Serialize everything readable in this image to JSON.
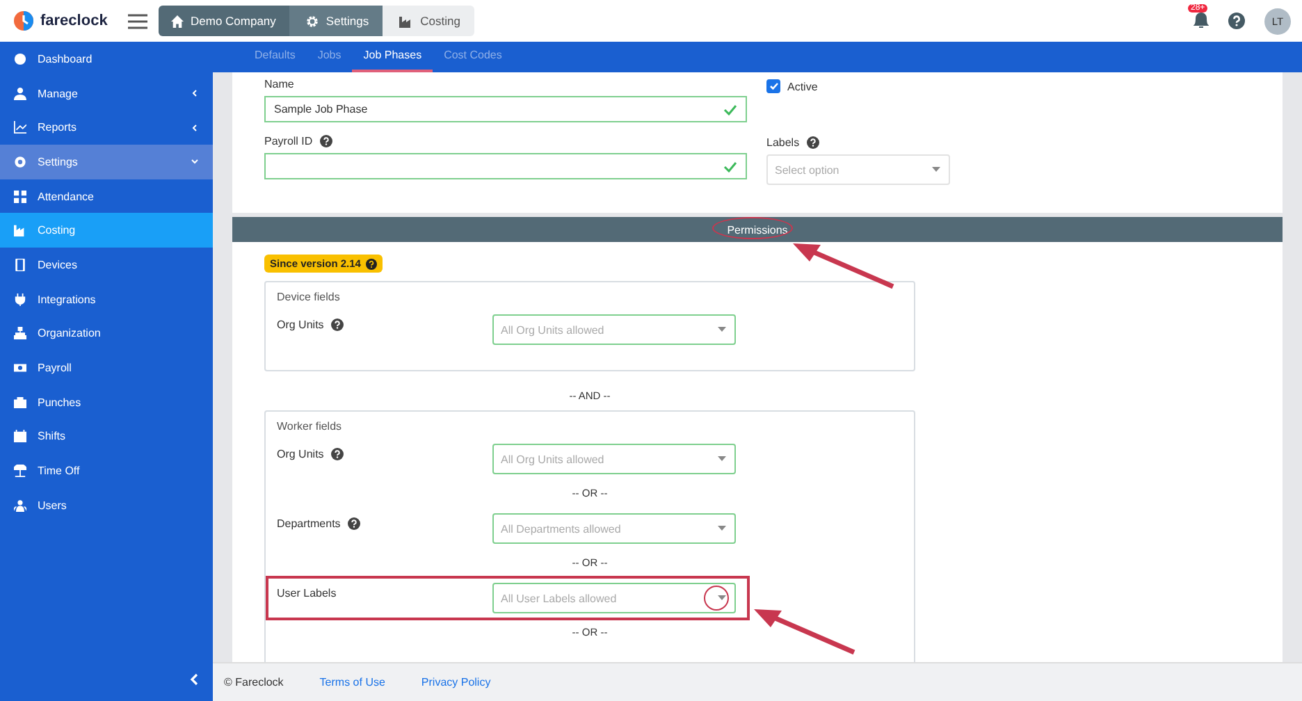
{
  "header": {
    "logo_text": "fareclock",
    "breadcrumbs": [
      {
        "label": "Demo Company",
        "kind": "home"
      },
      {
        "label": "Settings",
        "kind": "settings"
      },
      {
        "label": "Costing",
        "kind": "costing"
      }
    ],
    "notification_count": "28+",
    "avatar": "LT"
  },
  "sidebar": {
    "items": [
      {
        "label": "Dashboard",
        "kind": "dashboard",
        "selected": false,
        "has_submenu": false,
        "expanded": false
      },
      {
        "label": "Manage",
        "kind": "manage",
        "selected": false,
        "has_submenu": true,
        "expanded": false
      },
      {
        "label": "Reports",
        "kind": "reports",
        "selected": false,
        "has_submenu": true,
        "expanded": false
      },
      {
        "label": "Settings",
        "kind": "settings",
        "selected": false,
        "has_submenu": true,
        "expanded": true,
        "children": [
          {
            "label": "Attendance",
            "kind": "attendance",
            "selected": false,
            "has_submenu": false,
            "expanded": false
          },
          {
            "label": "Costing",
            "kind": "costing",
            "selected": true,
            "has_submenu": false,
            "expanded": false
          }
        ]
      },
      {
        "label": "Devices",
        "kind": "devices",
        "selected": false,
        "has_submenu": false,
        "expanded": false
      },
      {
        "label": "Integrations",
        "kind": "integrations",
        "selected": false,
        "has_submenu": false,
        "expanded": false
      },
      {
        "label": "Organization",
        "kind": "organization",
        "selected": false,
        "has_submenu": false,
        "expanded": false
      },
      {
        "label": "Payroll",
        "kind": "payroll",
        "selected": false,
        "has_submenu": false,
        "expanded": false
      },
      {
        "label": "Punches",
        "kind": "punches",
        "selected": false,
        "has_submenu": false,
        "expanded": false
      },
      {
        "label": "Shifts",
        "kind": "shifts",
        "selected": false,
        "has_submenu": false,
        "expanded": false
      },
      {
        "label": "Time Off",
        "kind": "timeoff",
        "selected": false,
        "has_submenu": false,
        "expanded": false
      },
      {
        "label": "Users",
        "kind": "users",
        "selected": false,
        "has_submenu": false,
        "expanded": false
      }
    ]
  },
  "tabs": [
    {
      "label": "Defaults",
      "selected": false
    },
    {
      "label": "Jobs",
      "selected": false
    },
    {
      "label": "Job Phases",
      "selected": true
    },
    {
      "label": "Cost Codes",
      "selected": false
    }
  ],
  "form": {
    "name": {
      "label": "Name",
      "value": "Sample Job Phase",
      "valid": true
    },
    "active": {
      "label": "Active",
      "checked": true
    },
    "payroll_id": {
      "label": "Payroll ID",
      "valid": true
    },
    "labels": {
      "label": "Labels",
      "placeholder": "Select option"
    }
  },
  "permissions": {
    "title": "Permissions",
    "badge": "Since version 2.14",
    "groups": [
      {
        "title": "Device fields",
        "items": [
          {
            "kind": "field",
            "label": "Org Units",
            "help": true,
            "placeholder": "All Org Units allowed"
          }
        ]
      },
      {
        "kind": "separator",
        "text": "-- AND --",
        "title": "Worker fields",
        "items": [
          {
            "kind": "field",
            "label": "Org Units",
            "help": true,
            "placeholder": "All Org Units allowed"
          },
          {
            "kind": "separator",
            "text": "-- OR --"
          },
          {
            "kind": "field",
            "label": "Departments",
            "help": true,
            "placeholder": "All Departments allowed"
          },
          {
            "kind": "separator",
            "text": "-- OR --"
          },
          {
            "kind": "field",
            "label": "User Labels",
            "help": false,
            "placeholder": "All User Labels allowed",
            "highlighted": true
          },
          {
            "kind": "separator",
            "text": "-- OR --"
          }
        ]
      }
    ]
  },
  "footer": {
    "copyright": "© Fareclock",
    "links": [
      "Terms of Use",
      "Privacy Policy"
    ]
  }
}
